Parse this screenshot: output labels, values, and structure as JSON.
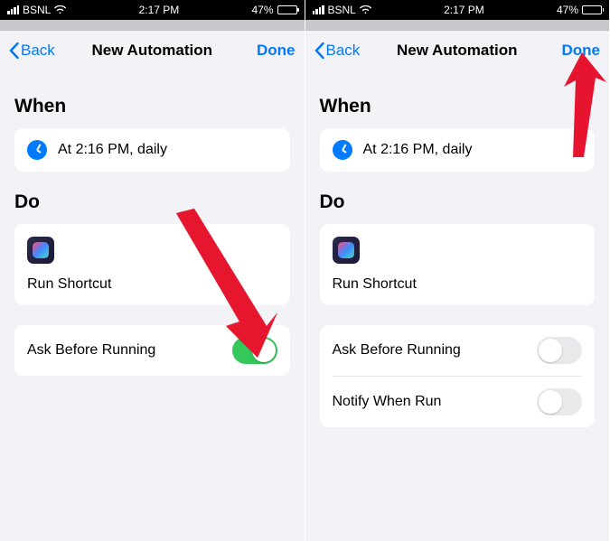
{
  "status": {
    "carrier": "BSNL",
    "time": "2:17 PM",
    "battery": "47%"
  },
  "left": {
    "nav": {
      "back": "Back",
      "title": "New Automation",
      "done": "Done"
    },
    "when": {
      "heading": "When",
      "trigger": "At 2:16 PM, daily"
    },
    "do": {
      "heading": "Do",
      "action": "Run Shortcut"
    },
    "options": {
      "ask": "Ask Before Running"
    }
  },
  "right": {
    "nav": {
      "back": "Back",
      "title": "New Automation",
      "done": "Done"
    },
    "when": {
      "heading": "When",
      "trigger": "At 2:16 PM, daily"
    },
    "do": {
      "heading": "Do",
      "action": "Run Shortcut"
    },
    "options": {
      "ask": "Ask Before Running",
      "notify": "Notify When Run"
    }
  }
}
